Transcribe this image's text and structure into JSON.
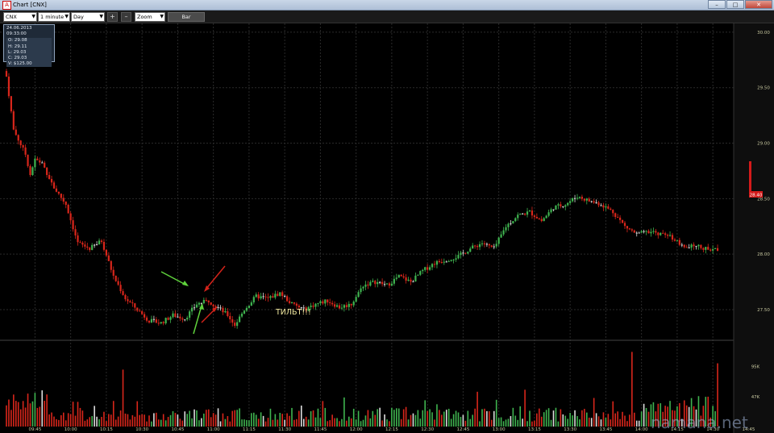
{
  "window": {
    "title": "Chart [CNX]",
    "minimize": "–",
    "maximize": "□",
    "close": "✕",
    "app_icon": "A"
  },
  "toolbar": {
    "symbol": "CNX",
    "interval": "1 minute",
    "period": "Day",
    "zoom_in": "+",
    "zoom_out": "–",
    "zoom": "Zoom",
    "bar_button": "Bar"
  },
  "info": {
    "datetime": "24.06.2013 09:33:00",
    "open": "O: 29.08",
    "high": "H: 29.11",
    "low": "L: 29.03",
    "close": "C: 29.03",
    "volume": "V: $125.00"
  },
  "annotation": "ТИЛЬТ!!!",
  "watermark": "namana.net",
  "colors": {
    "up": "#3fb34f",
    "down": "#d8261b",
    "neutral": "#dcdcdc",
    "axis_text": "#c8c8a0",
    "grid": "#2a2a2a",
    "arrow_green": "#5fd23c",
    "arrow_red": "#d4231a",
    "price_tag": "#d41a1a"
  },
  "chart_data": {
    "type": "candlestick",
    "symbol": "CNX",
    "price_axis_labels": [
      "30.00",
      "29.50",
      "29.00",
      "28.50",
      "28.00",
      "27.50"
    ],
    "price_ticks": [
      30.0,
      29.5,
      29.0,
      28.5,
      28.0,
      27.5
    ],
    "price_range": [
      27.26,
      30.05
    ],
    "current_price_label": "28.40",
    "volume_axis_labels": [
      "95K",
      "47K"
    ],
    "volume_ticks": [
      95000,
      47000
    ],
    "time_labels": [
      "09:45",
      "10:00",
      "10:15",
      "10:30",
      "10:45",
      "11:00",
      "11:15",
      "11:30",
      "11:45",
      "12:00",
      "12:15",
      "12:30",
      "12:45",
      "13:00",
      "13:15",
      "13:30",
      "13:45",
      "14:00",
      "14:15",
      "14:30",
      "14:45",
      "15:00",
      "15:15"
    ],
    "close_path": [
      [
        0,
        29.6
      ],
      [
        3,
        29.12
      ],
      [
        8,
        28.9
      ],
      [
        10,
        28.72
      ],
      [
        12,
        28.85
      ],
      [
        15,
        28.82
      ],
      [
        20,
        28.6
      ],
      [
        25,
        28.45
      ],
      [
        30,
        28.1
      ],
      [
        35,
        28.05
      ],
      [
        40,
        28.12
      ],
      [
        45,
        27.8
      ],
      [
        50,
        27.6
      ],
      [
        55,
        27.5
      ],
      [
        60,
        27.4
      ],
      [
        65,
        27.38
      ],
      [
        70,
        27.45
      ],
      [
        75,
        27.42
      ],
      [
        80,
        27.55
      ],
      [
        85,
        27.58
      ],
      [
        90,
        27.5
      ],
      [
        93,
        27.45
      ],
      [
        96,
        27.36
      ],
      [
        100,
        27.5
      ],
      [
        105,
        27.62
      ],
      [
        110,
        27.6
      ],
      [
        115,
        27.65
      ],
      [
        120,
        27.55
      ],
      [
        125,
        27.5
      ],
      [
        130,
        27.55
      ],
      [
        135,
        27.58
      ],
      [
        140,
        27.52
      ],
      [
        145,
        27.55
      ],
      [
        150,
        27.72
      ],
      [
        155,
        27.75
      ],
      [
        160,
        27.72
      ],
      [
        165,
        27.8
      ],
      [
        170,
        27.75
      ],
      [
        175,
        27.85
      ],
      [
        180,
        27.92
      ],
      [
        185,
        27.95
      ],
      [
        190,
        27.98
      ],
      [
        195,
        28.05
      ],
      [
        200,
        28.1
      ],
      [
        205,
        28.05
      ],
      [
        210,
        28.25
      ],
      [
        215,
        28.35
      ],
      [
        220,
        28.38
      ],
      [
        225,
        28.3
      ],
      [
        230,
        28.42
      ],
      [
        235,
        28.45
      ],
      [
        240,
        28.52
      ],
      [
        245,
        28.48
      ],
      [
        250,
        28.45
      ],
      [
        255,
        28.38
      ],
      [
        260,
        28.25
      ],
      [
        265,
        28.18
      ],
      [
        270,
        28.2
      ],
      [
        275,
        28.18
      ],
      [
        280,
        28.15
      ],
      [
        285,
        28.05
      ],
      [
        290,
        28.08
      ],
      [
        295,
        28.04
      ]
    ]
  }
}
